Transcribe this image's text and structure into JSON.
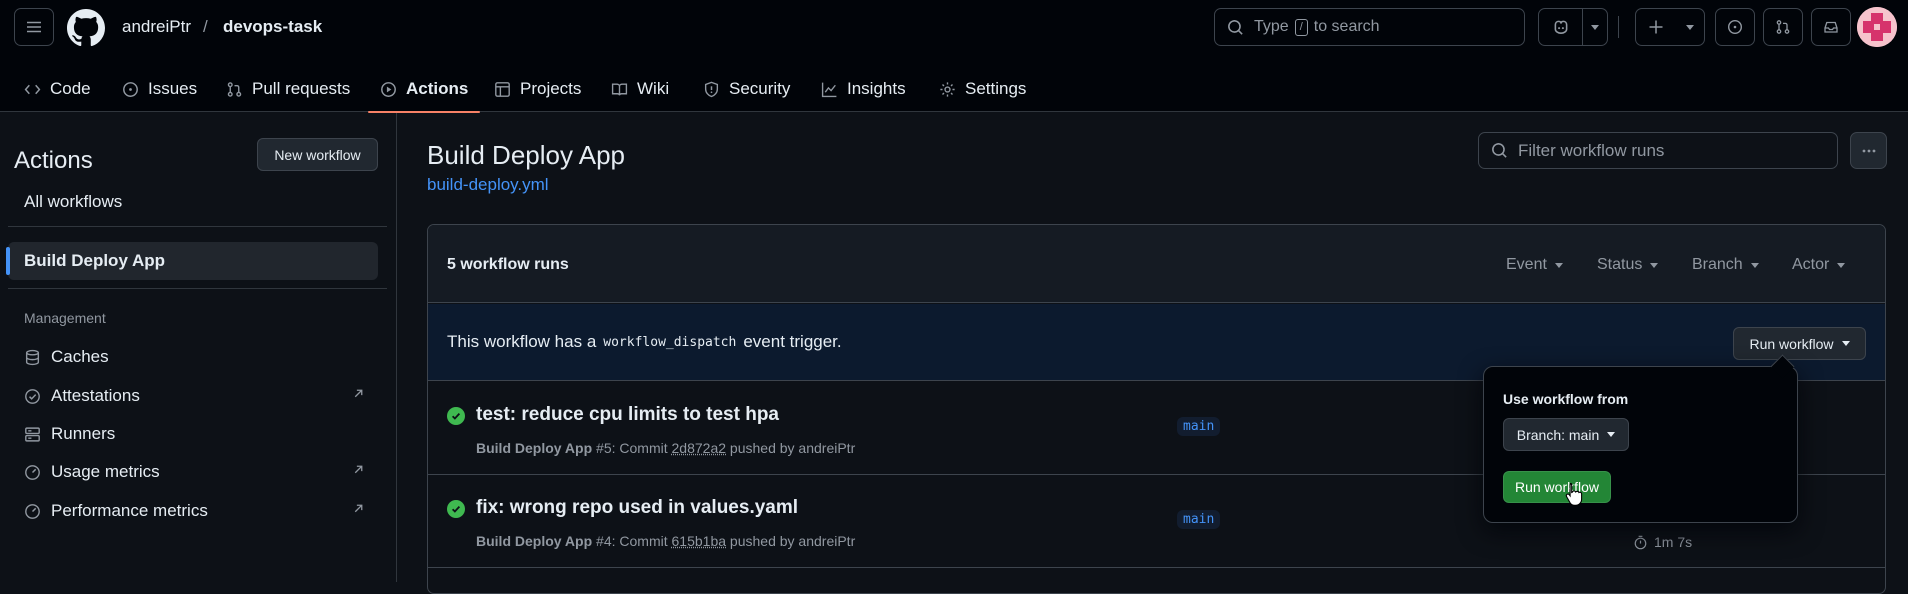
{
  "header": {
    "owner": "andreiPtr",
    "separator": "/",
    "repo": "devops-task",
    "search": {
      "prefix": "Type",
      "key": "/",
      "suffix": "to search"
    }
  },
  "repo_nav": [
    {
      "label": "Code",
      "icon": "code-icon"
    },
    {
      "label": "Issues",
      "icon": "issue-opened-icon"
    },
    {
      "label": "Pull requests",
      "icon": "git-pull-request-icon"
    },
    {
      "label": "Actions",
      "icon": "play-icon",
      "active": true
    },
    {
      "label": "Projects",
      "icon": "table-icon"
    },
    {
      "label": "Wiki",
      "icon": "book-icon"
    },
    {
      "label": "Security",
      "icon": "shield-icon"
    },
    {
      "label": "Insights",
      "icon": "graph-icon"
    },
    {
      "label": "Settings",
      "icon": "gear-icon"
    }
  ],
  "sidebar": {
    "title": "Actions",
    "new_workflow": "New workflow",
    "all_workflows": "All workflows",
    "selected_workflow": "Build Deploy App",
    "management_heading": "Management",
    "management_items": [
      {
        "label": "Caches",
        "icon": "database-icon",
        "external": false
      },
      {
        "label": "Attestations",
        "icon": "verified-icon",
        "external": true
      },
      {
        "label": "Runners",
        "icon": "server-icon",
        "external": false
      },
      {
        "label": "Usage metrics",
        "icon": "meter-icon",
        "external": true
      },
      {
        "label": "Performance metrics",
        "icon": "meter-icon",
        "external": true
      }
    ]
  },
  "main": {
    "title": "Build Deploy App",
    "file": "build-deploy.yml",
    "filter_placeholder": "Filter workflow runs",
    "runs_count": "5 workflow runs",
    "filters": [
      "Event",
      "Status",
      "Branch",
      "Actor"
    ],
    "dispatch": {
      "prefix": "This workflow has a",
      "code": "workflow_dispatch",
      "suffix": "event trigger.",
      "button": "Run workflow"
    },
    "runs": [
      {
        "title": "test: reduce cpu limits to test hpa",
        "workflow": "Build Deploy App",
        "number": "#5",
        "commit_label": ": Commit",
        "sha": "2d872a2",
        "pushed_by": "pushed by andreiPtr",
        "branch": "main",
        "duration": ""
      },
      {
        "title": "fix: wrong repo used in values.yaml",
        "workflow": "Build Deploy App",
        "number": "#4",
        "commit_label": ": Commit",
        "sha": "615b1ba",
        "pushed_by": "pushed by andreiPtr",
        "branch": "main",
        "duration": "1m 7s"
      }
    ]
  },
  "popover": {
    "label": "Use workflow from",
    "branch_button": "Branch: main",
    "run_button": "Run workflow"
  },
  "colors": {
    "success": "#3fb950",
    "accent": "#4493f8",
    "active_underline": "#f78166",
    "run_button": "#238636"
  }
}
